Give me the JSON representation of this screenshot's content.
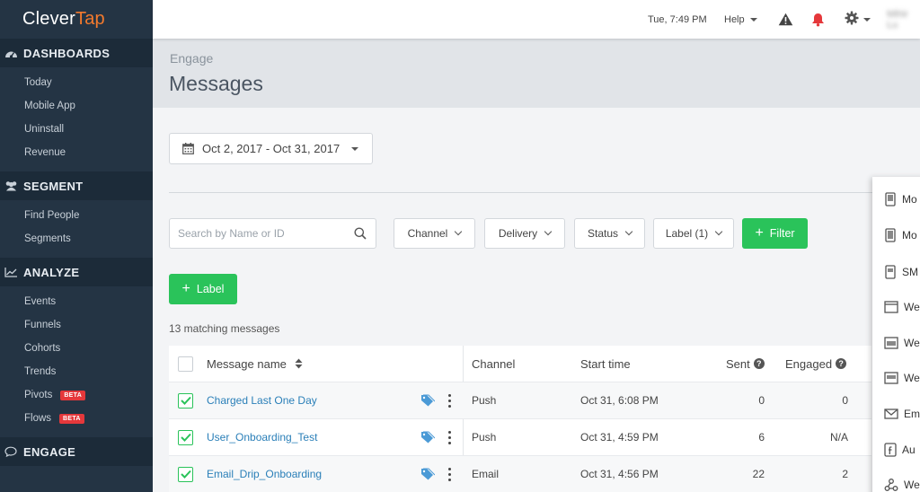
{
  "app": {
    "name_part1": "Clever",
    "name_part2": "Tap"
  },
  "sidebar": {
    "sections": [
      {
        "title": "DASHBOARDS",
        "icon": "dashboard-icon",
        "items": [
          "Today",
          "Mobile App",
          "Uninstall",
          "Revenue"
        ]
      },
      {
        "title": "SEGMENT",
        "icon": "users-icon",
        "items": [
          "Find People",
          "Segments"
        ]
      },
      {
        "title": "ANALYZE",
        "icon": "chart-line-icon",
        "items": [
          "Events",
          "Funnels",
          "Cohorts",
          "Trends",
          "Pivots",
          "Flows"
        ],
        "badges": {
          "Pivots": "BETA",
          "Flows": "BETA"
        }
      },
      {
        "title": "ENGAGE",
        "icon": "chat-bubble-icon",
        "items": []
      }
    ]
  },
  "topbar": {
    "time": "Tue, 7:49 PM",
    "help": "Help",
    "user": "Mihir Lu"
  },
  "header": {
    "breadcrumb": "Engage",
    "title": "Messages"
  },
  "date_range": {
    "label": "Oct 2, 2017 - Oct 31, 2017"
  },
  "search": {
    "placeholder": "Search by Name or ID"
  },
  "filters": {
    "channel": "Channel",
    "delivery": "Delivery",
    "status": "Status",
    "label": "Label (1)",
    "filter_button": "Filter"
  },
  "label_button": "Label",
  "match_count": "13 matching messages",
  "table": {
    "columns": {
      "name": "Message name",
      "channel": "Channel",
      "start": "Start time",
      "sent": "Sent",
      "engaged": "Engaged"
    },
    "rows": [
      {
        "name": "Charged Last One Day",
        "channel": "Push",
        "start": "Oct 31, 6:08 PM",
        "sent": "0",
        "engaged": "0"
      },
      {
        "name": "User_Onboarding_Test",
        "channel": "Push",
        "start": "Oct 31, 4:59 PM",
        "sent": "6",
        "engaged": "N/A"
      },
      {
        "name": "Email_Drip_Onboarding",
        "channel": "Email",
        "start": "Oct 31, 4:56 PM",
        "sent": "22",
        "engaged": "2"
      }
    ]
  },
  "channel_menu": [
    "Mo",
    "Mo",
    "SM",
    "We",
    "We",
    "We",
    "Em",
    "Au",
    "We"
  ],
  "colors": {
    "sidebar": "#243444",
    "accent_green": "#2ac35a",
    "brand_orange": "#f47a2d",
    "alert_red": "#e5383b",
    "link_blue": "#2a7fb8"
  }
}
